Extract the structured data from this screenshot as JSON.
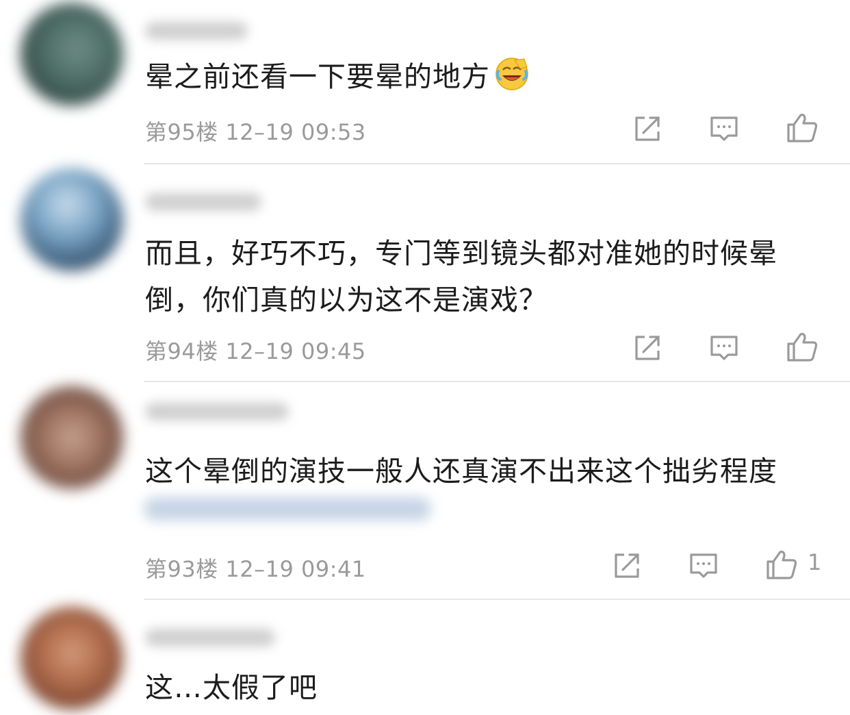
{
  "comments": [
    {
      "text": "晕之前还看一下要晕的地方",
      "emoji": "laughing-crying-emoji",
      "floor": "第95楼",
      "time": "12–19 09:53",
      "likes": ""
    },
    {
      "text": "而且，好巧不巧，专门等到镜头都对准她的时候晕倒，你们真的以为这不是演戏？",
      "floor": "第94楼",
      "time": "12–19 09:45",
      "likes": ""
    },
    {
      "text": "这个晕倒的演技一般人还真演不出来这个拙劣程度",
      "floor": "第93楼",
      "time": "12–19 09:41",
      "likes": "1"
    },
    {
      "text": "这…太假了吧"
    }
  ],
  "icons": {
    "share": "share-icon",
    "reply": "comment-icon",
    "like": "thumbs-up-icon"
  },
  "colors": {
    "meta_text": "#9a9a9a",
    "icon_stroke": "#9a9a9a",
    "divider": "#e6e6e6",
    "body_text": "#1c1c1c"
  }
}
